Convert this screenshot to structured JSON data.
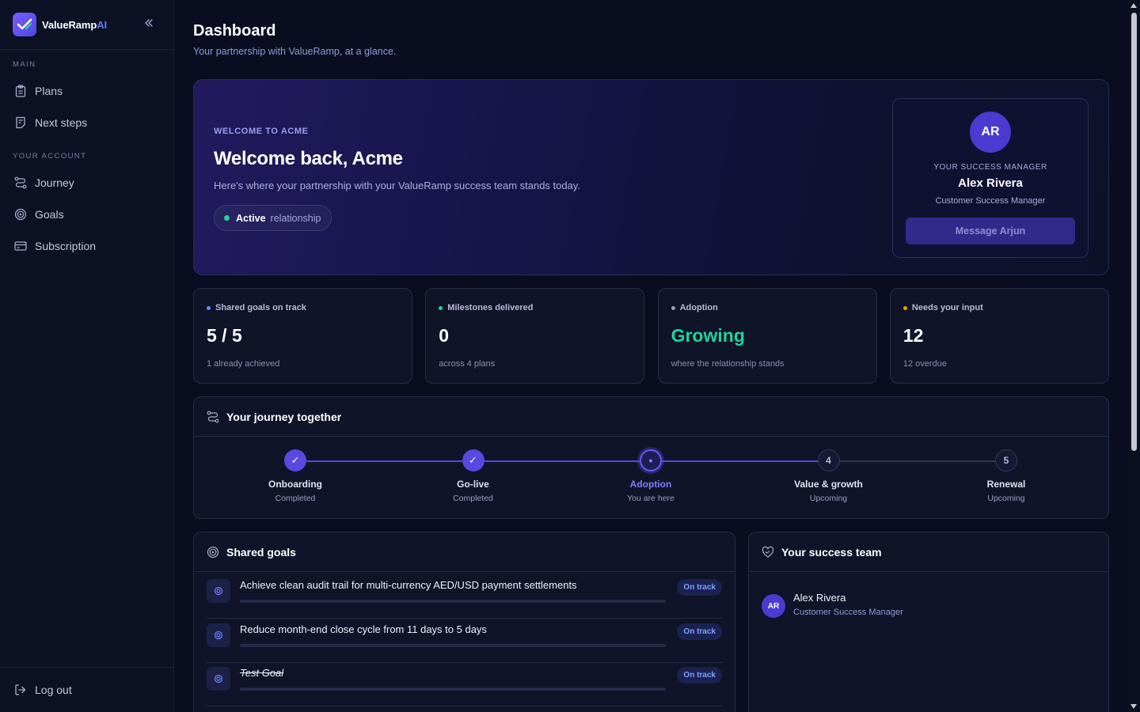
{
  "brand": {
    "name": "ValueRamp",
    "suffix": "AI"
  },
  "sidebar": {
    "main_label": "MAIN",
    "main_items": [
      {
        "label": "Plans",
        "icon": "clipboard-icon"
      },
      {
        "label": "Next steps",
        "icon": "checklist-icon"
      }
    ],
    "account_label": "YOUR ACCOUNT",
    "account_items": [
      {
        "label": "Journey",
        "icon": "route-icon"
      },
      {
        "label": "Goals",
        "icon": "target-icon"
      },
      {
        "label": "Subscription",
        "icon": "card-icon"
      }
    ],
    "logout_label": "Log out"
  },
  "page": {
    "title": "Dashboard",
    "subtitle": "Your partnership with ValueRamp, at a glance."
  },
  "hero": {
    "eyebrow": "WELCOME TO ACME",
    "title": "Welcome back, Acme",
    "subtitle": "Here's where your partnership with your ValueRamp success team stands today.",
    "status_bold": "Active",
    "status_rest": "relationship"
  },
  "manager": {
    "initials": "AR",
    "eyebrow": "YOUR SUCCESS MANAGER",
    "name": "Alex Rivera",
    "role": "Customer Success Manager",
    "button": "Message Arjun"
  },
  "stats": [
    {
      "label": "Shared goals on track",
      "value": "5 / 5",
      "sub": "1 already achieved",
      "dot": "#6a8bff",
      "value_color": "#ffffff"
    },
    {
      "label": "Milestones delivered",
      "value": "0",
      "sub": "across 4 plans",
      "dot": "#22d39a",
      "value_color": "#ffffff"
    },
    {
      "label": "Adoption",
      "value": "Growing",
      "sub": "where the relationship stands",
      "dot": "#9aa0bd",
      "value_color": "#22d39a"
    },
    {
      "label": "Needs your input",
      "value": "12",
      "sub": "12 overdue",
      "dot": "#f59e0b",
      "value_color": "#ffffff"
    }
  ],
  "journey": {
    "title": "Your journey together",
    "steps": [
      {
        "name": "Onboarding",
        "status": "Completed",
        "state": "done",
        "marker": "✓"
      },
      {
        "name": "Go-live",
        "status": "Completed",
        "state": "done",
        "marker": "✓"
      },
      {
        "name": "Adoption",
        "status": "You are here",
        "state": "current",
        "marker": "●"
      },
      {
        "name": "Value & growth",
        "status": "Upcoming",
        "state": "upcoming",
        "marker": "4"
      },
      {
        "name": "Renewal",
        "status": "Upcoming",
        "state": "upcoming",
        "marker": "5"
      }
    ]
  },
  "goals": {
    "title": "Shared goals",
    "items": [
      {
        "text": "Achieve clean audit trail for multi-currency AED/USD payment settlements",
        "status": "On track",
        "progress": 0
      },
      {
        "text": "Reduce month-end close cycle from 11 days to 5 days",
        "status": "On track",
        "progress": 0
      },
      {
        "text": "Test Goal",
        "status": "On track",
        "progress": 0
      }
    ]
  },
  "team": {
    "title": "Your success team",
    "members": [
      {
        "initials": "AR",
        "name": "Alex Rivera",
        "role": "Customer Success Manager"
      }
    ]
  },
  "colors": {
    "accent": "#4b3bd0",
    "success": "#22d39a",
    "warning": "#f59e0b",
    "background": "#090d1f"
  }
}
